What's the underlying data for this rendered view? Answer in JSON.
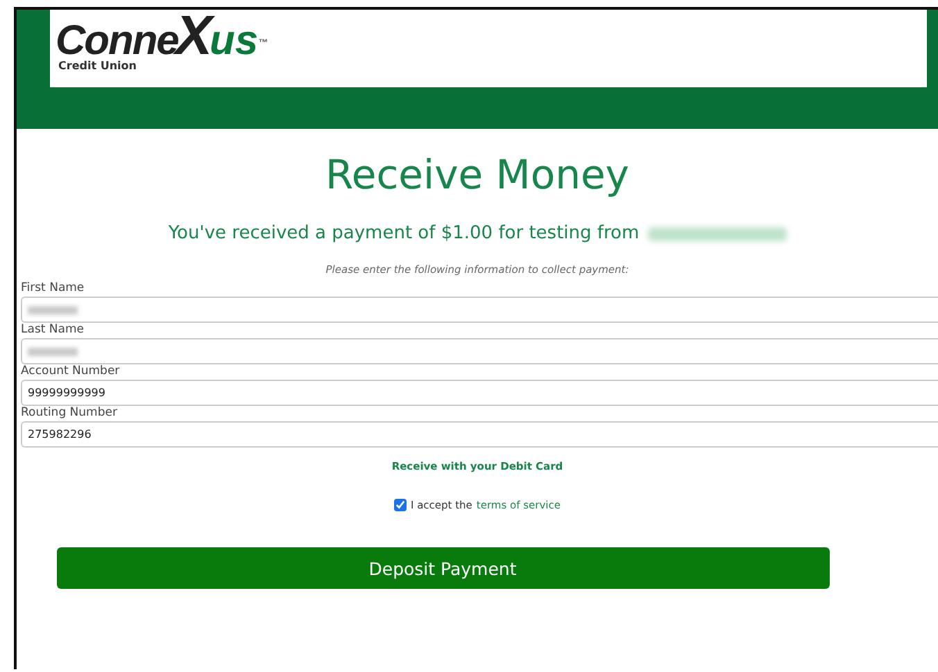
{
  "logo": {
    "word_start": "Conne",
    "word_mark": "X",
    "word_end": "us",
    "trademark": "™",
    "subtitle": "Credit Union"
  },
  "title": "Receive Money",
  "message": {
    "text": "You've received a payment of $1.00 for testing from",
    "sender_redacted": true
  },
  "instructions": "Please enter the following information to collect payment:",
  "fields": [
    {
      "label": "First Name",
      "redacted": true
    },
    {
      "label": "Last Name",
      "redacted": true
    },
    {
      "label": "Account Number",
      "value": "99999999999",
      "redacted": false
    },
    {
      "label": "Routing Number",
      "value": "275982296",
      "redacted": false
    }
  ],
  "debit_link": "Receive with your Debit Card",
  "terms": {
    "checked": true,
    "text": "I accept the",
    "link": "terms of service"
  },
  "button": "Deposit Payment"
}
